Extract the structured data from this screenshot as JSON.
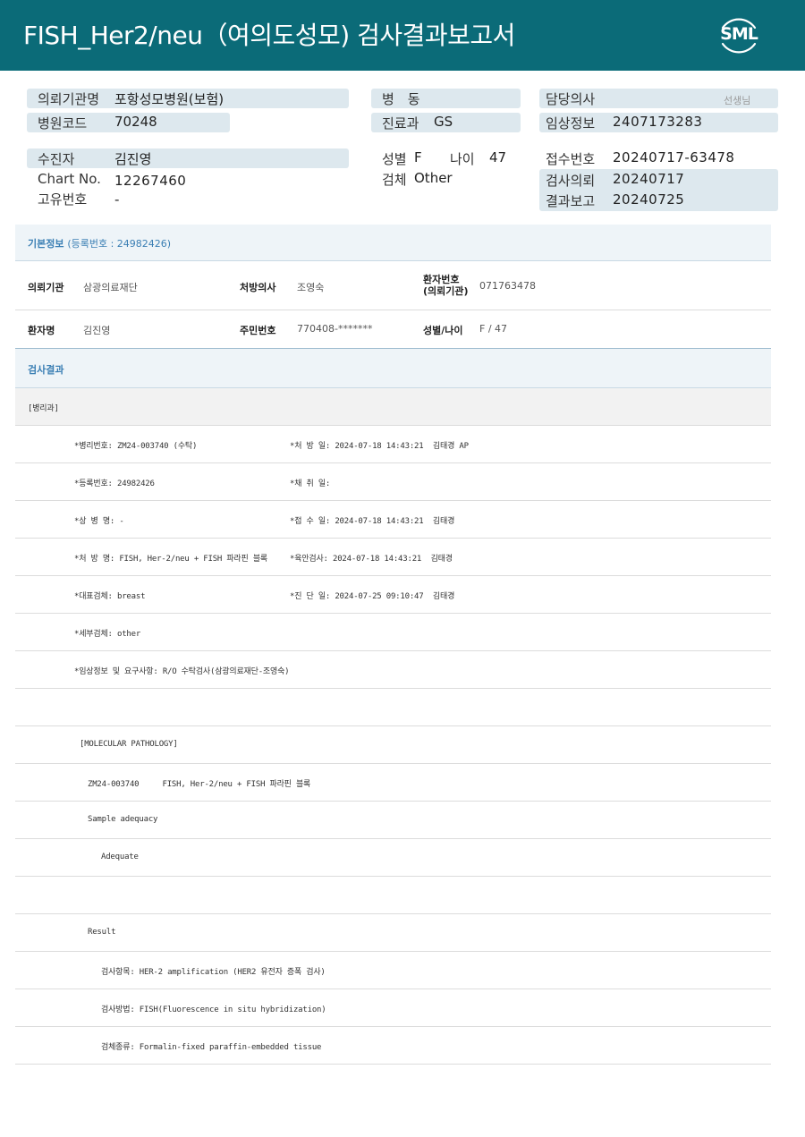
{
  "header": {
    "title": "FISH_Her2/neu（여의도성모) 검사결과보고서",
    "logo": "SML"
  },
  "summary": {
    "institution_label": "의뢰기관명",
    "institution_value": "포항성모병원(보험)",
    "hospital_code_label": "병원코드",
    "hospital_code_value": "70248",
    "ward_label": "병　동",
    "ward_value": "",
    "dept_label": "진료과",
    "dept_value": "GS",
    "doctor_label": "담당의사",
    "doctor_value": "",
    "doctor_suffix": "선생님",
    "clinical_label": "임상정보",
    "clinical_value": "2407173283",
    "patient_label": "수진자",
    "patient_value": "김진영",
    "chart_label": "Chart No.",
    "chart_value": "12267460",
    "unique_label": "고유번호",
    "unique_value": "-",
    "sex_label": "성별",
    "sex_value": "F",
    "age_label": "나이",
    "age_value": "47",
    "specimen_label": "검체",
    "specimen_value": "Other",
    "receipt_label": "접수번호",
    "receipt_value": "20240717-63478",
    "request_label": "검사의뢰",
    "request_value": "20240717",
    "report_label": "결과보고",
    "report_value": "20240725"
  },
  "basic_info": {
    "title": "기본정보",
    "reg_label": "(등록번호 : 24982426)",
    "row1": {
      "k1": "의뢰기관",
      "v1": "삼광의료재단",
      "k2": "처방의사",
      "v2": "조영숙",
      "k3_line1": "환자번호",
      "k3_line2": "(의뢰기관)",
      "v3": "071763478"
    },
    "row2": {
      "k1": "환자명",
      "v1": "김진영",
      "k2": "주민번호",
      "v2": "770408-*******",
      "k3": "성별/나이",
      "v3": "F / 47"
    }
  },
  "results": {
    "title": "검사결과",
    "category": "[병리과]",
    "rows": [
      {
        "left": "*병리번호: ZM24-003740 (수탁)",
        "right": "*처 방 일: 2024-07-18 14:43:21  김태경 AP"
      },
      {
        "left": "*등록번호: 24982426",
        "right": "*채 취 일:"
      },
      {
        "left": "*상 병 명: -",
        "right": "*접 수 일: 2024-07-18 14:43:21  김태경"
      },
      {
        "left": "*처 방 명: FISH, Her-2/neu + FISH 파라핀 블록",
        "right": "*육안검사: 2024-07-18 14:43:21  김태경"
      },
      {
        "left": "*대표검체: breast",
        "right": "*진 단 일: 2024-07-25 09:10:47  김태경"
      },
      {
        "left": "*세부검체: other",
        "right": ""
      },
      {
        "left": "*임상정보 및 요구사항: R/O 수탁검사(삼광의료재단-조영숙)",
        "right": ""
      },
      {
        "left": "",
        "right": ""
      },
      {
        "left": "[MOLECULAR PATHOLOGY]",
        "right": ""
      },
      {
        "left": "ZM24-003740     FISH, Her-2/neu + FISH 파라핀 블록",
        "right": ""
      },
      {
        "left": "Sample adequacy",
        "right": ""
      },
      {
        "left": "Adequate",
        "right": ""
      },
      {
        "left": "",
        "right": ""
      },
      {
        "left": "Result",
        "right": ""
      },
      {
        "left": "검사항목: HER-2 amplification (HER2 유전자 증폭 검사)",
        "right": ""
      },
      {
        "left": "검사방법: FISH(Fluorescence in situ hybridization)",
        "right": ""
      },
      {
        "left": "검체종류: Formalin-fixed paraffin-embedded tissue",
        "right": ""
      }
    ]
  },
  "colors": {
    "header_bg": "#0b6b78",
    "pill_bg": "#dde8ee",
    "section_title": "#3b7fb4"
  }
}
